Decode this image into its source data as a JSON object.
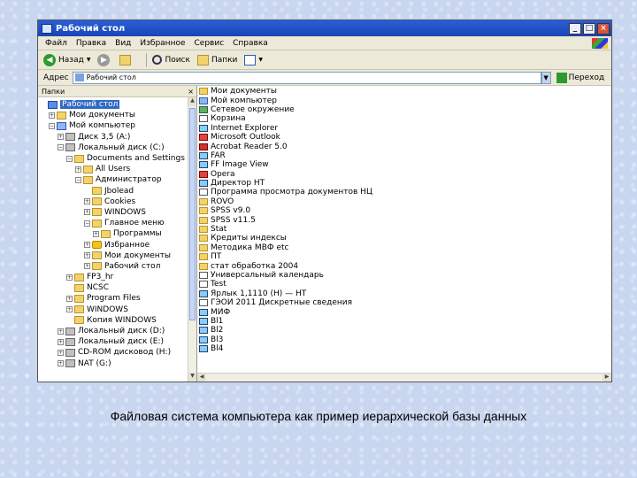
{
  "window": {
    "title": "Рабочий стол",
    "controls": {
      "minimize": "_",
      "maximize": "□",
      "close": "×"
    }
  },
  "menu": [
    "Файл",
    "Правка",
    "Вид",
    "Избранное",
    "Сервис",
    "Справка"
  ],
  "toolbar": {
    "back": "Назад",
    "search": "Поиск",
    "folders": "Папки"
  },
  "address": {
    "label": "Адрес",
    "value": "Рабочий стол",
    "go": "Переход"
  },
  "left_pane": {
    "header": "Папки",
    "close": "×",
    "tree": [
      {
        "label": "Рабочий стол",
        "level": 0,
        "toggle": "",
        "icon": "desktop",
        "selected": true
      },
      {
        "label": "Мои документы",
        "level": 1,
        "toggle": "+",
        "icon": "folder"
      },
      {
        "label": "Мой компьютер",
        "level": 1,
        "toggle": "−",
        "icon": "computer"
      },
      {
        "label": "Диск 3,5 (A:)",
        "level": 2,
        "toggle": "+",
        "icon": "drive"
      },
      {
        "label": "Локальный диск (C:)",
        "level": 2,
        "toggle": "−",
        "icon": "drive"
      },
      {
        "label": "Documents and Settings",
        "level": 3,
        "toggle": "−",
        "icon": "folder"
      },
      {
        "label": "All Users",
        "level": 4,
        "toggle": "+",
        "icon": "folder"
      },
      {
        "label": "Администратор",
        "level": 4,
        "toggle": "−",
        "icon": "folder"
      },
      {
        "label": "Jbolead",
        "level": 5,
        "toggle": "",
        "icon": "folder"
      },
      {
        "label": "Cookies",
        "level": 5,
        "toggle": "+",
        "icon": "folder"
      },
      {
        "label": "WINDOWS",
        "level": 5,
        "toggle": "+",
        "icon": "folder"
      },
      {
        "label": "Главное меню",
        "level": 5,
        "toggle": "−",
        "icon": "folder"
      },
      {
        "label": "Программы",
        "level": 6,
        "toggle": "+",
        "icon": "folder"
      },
      {
        "label": "Избранное",
        "level": 5,
        "toggle": "+",
        "icon": "star"
      },
      {
        "label": "Мои документы",
        "level": 5,
        "toggle": "+",
        "icon": "folder"
      },
      {
        "label": "Рабочий стол",
        "level": 5,
        "toggle": "+",
        "icon": "folder"
      },
      {
        "label": "FP3_hr",
        "level": 3,
        "toggle": "+",
        "icon": "folder"
      },
      {
        "label": "NCSC",
        "level": 3,
        "toggle": "",
        "icon": "folder"
      },
      {
        "label": "Program Files",
        "level": 3,
        "toggle": "+",
        "icon": "folder"
      },
      {
        "label": "WINDOWS",
        "level": 3,
        "toggle": "+",
        "icon": "folder"
      },
      {
        "label": "Копия WINDOWS",
        "level": 3,
        "toggle": "",
        "icon": "folder"
      },
      {
        "label": "Локальный диск (D:)",
        "level": 2,
        "toggle": "+",
        "icon": "drive"
      },
      {
        "label": "Локальный диск (E:)",
        "level": 2,
        "toggle": "+",
        "icon": "drive"
      },
      {
        "label": "CD-ROM дисковод (H:)",
        "level": 2,
        "toggle": "+",
        "icon": "drive"
      },
      {
        "label": "NAT (G:)",
        "level": 2,
        "toggle": "+",
        "icon": "drive"
      }
    ]
  },
  "right_pane": {
    "items": [
      {
        "label": "Мои документы",
        "icon": "folder"
      },
      {
        "label": "Мой компьютер",
        "icon": "computer"
      },
      {
        "label": "Сетевое окружение",
        "icon": "net"
      },
      {
        "label": "Корзина",
        "icon": "doc"
      },
      {
        "label": "Internet Explorer",
        "icon": "exe"
      },
      {
        "label": "Microsoft Outlook",
        "icon": "app"
      },
      {
        "label": "Acrobat Reader 5.0",
        "icon": "pdf"
      },
      {
        "label": "FAR",
        "icon": "exe"
      },
      {
        "label": "FF Image View",
        "icon": "exe"
      },
      {
        "label": "Opera",
        "icon": "app"
      },
      {
        "label": "Директор НТ",
        "icon": "exe"
      },
      {
        "label": "Программа просмотра документов НЦ",
        "icon": "doc"
      },
      {
        "label": "ROVO",
        "icon": "folder"
      },
      {
        "label": "SPSS v9.0",
        "icon": "folder"
      },
      {
        "label": "SPSS v11.5",
        "icon": "folder"
      },
      {
        "label": "Stat",
        "icon": "folder"
      },
      {
        "label": "Кредиты индексы",
        "icon": "folder"
      },
      {
        "label": "Методика МВФ etc",
        "icon": "folder"
      },
      {
        "label": "ПТ",
        "icon": "folder"
      },
      {
        "label": "стат обработка 2004",
        "icon": "folder"
      },
      {
        "label": "Универсальный календарь",
        "icon": "doc"
      },
      {
        "label": "Test",
        "icon": "doc"
      },
      {
        "label": "Ярлык 1,1110 (H) — НТ",
        "icon": "exe"
      },
      {
        "label": "ГЭОИ 2011 Дискретные сведения",
        "icon": "doc"
      },
      {
        "label": "МИФ",
        "icon": "exe"
      },
      {
        "label": "Bl1",
        "icon": "exe"
      },
      {
        "label": "Bl2",
        "icon": "exe"
      },
      {
        "label": "Bl3",
        "icon": "exe"
      },
      {
        "label": "Bl4",
        "icon": "exe"
      }
    ]
  },
  "caption": "Файловая система компьютера как пример иерархической базы данных"
}
